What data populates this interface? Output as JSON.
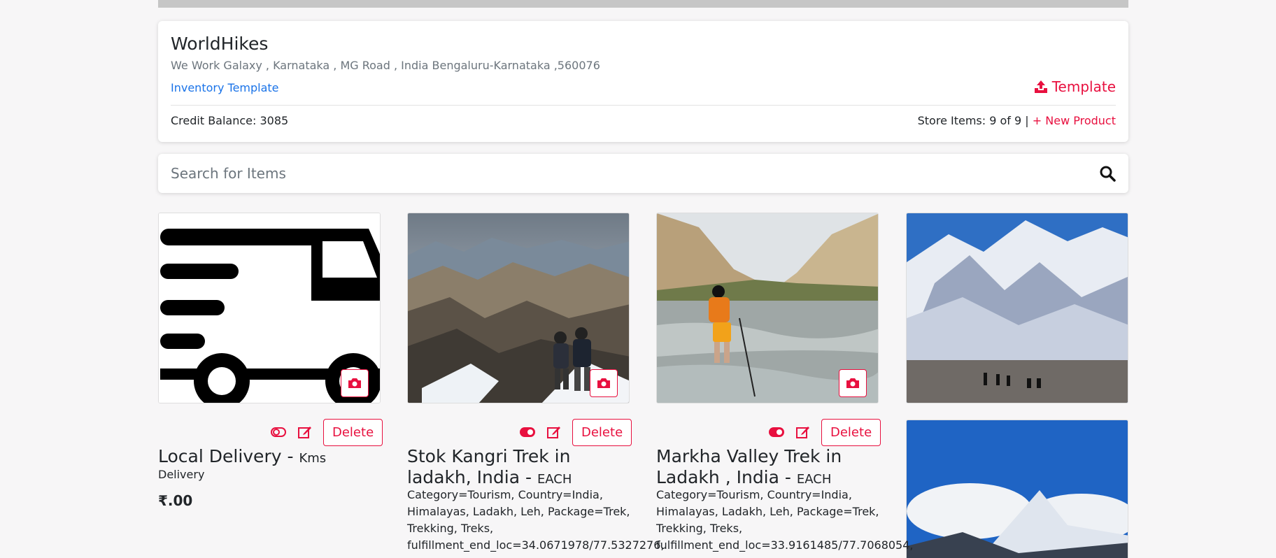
{
  "store": {
    "name": "WorldHikes",
    "address": "We Work Galaxy , Karnataka , MG Road , India Bengaluru-Karnataka ,560076",
    "inventory_link": "Inventory Template",
    "template_button": "Template",
    "credit_balance": "Credit Balance: 3085",
    "store_items": "Store Items: 9 of 9 |",
    "new_product": "+ New Product"
  },
  "search": {
    "placeholder": "Search for Items"
  },
  "colors": {
    "accent": "#e8103f",
    "link": "#1a73e8"
  },
  "products": [
    {
      "title": "Local Delivery - ",
      "unit": "Kms",
      "subtitle": "Delivery",
      "price": "₹.00",
      "delete_label": "Delete"
    },
    {
      "title": "Stok Kangri Trek in ladakh, India - ",
      "unit": "EACH",
      "description": "Category=Tourism, Country=India, Himalayas, Ladakh, Leh, Package=Trek, Trekking, Treks, fulfillment_end_loc=34.0671978/77.5327276,",
      "delete_label": "Delete"
    },
    {
      "title": "Markha Valley Trek in Ladakh , India - ",
      "unit": "EACH",
      "description": "Category=Tourism, Country=India, Himalayas, Ladakh, Leh, Package=Trek, Trekking, Treks, fulfillment_end_loc=33.9161485/77.7068054,",
      "delete_label": "Delete"
    }
  ]
}
